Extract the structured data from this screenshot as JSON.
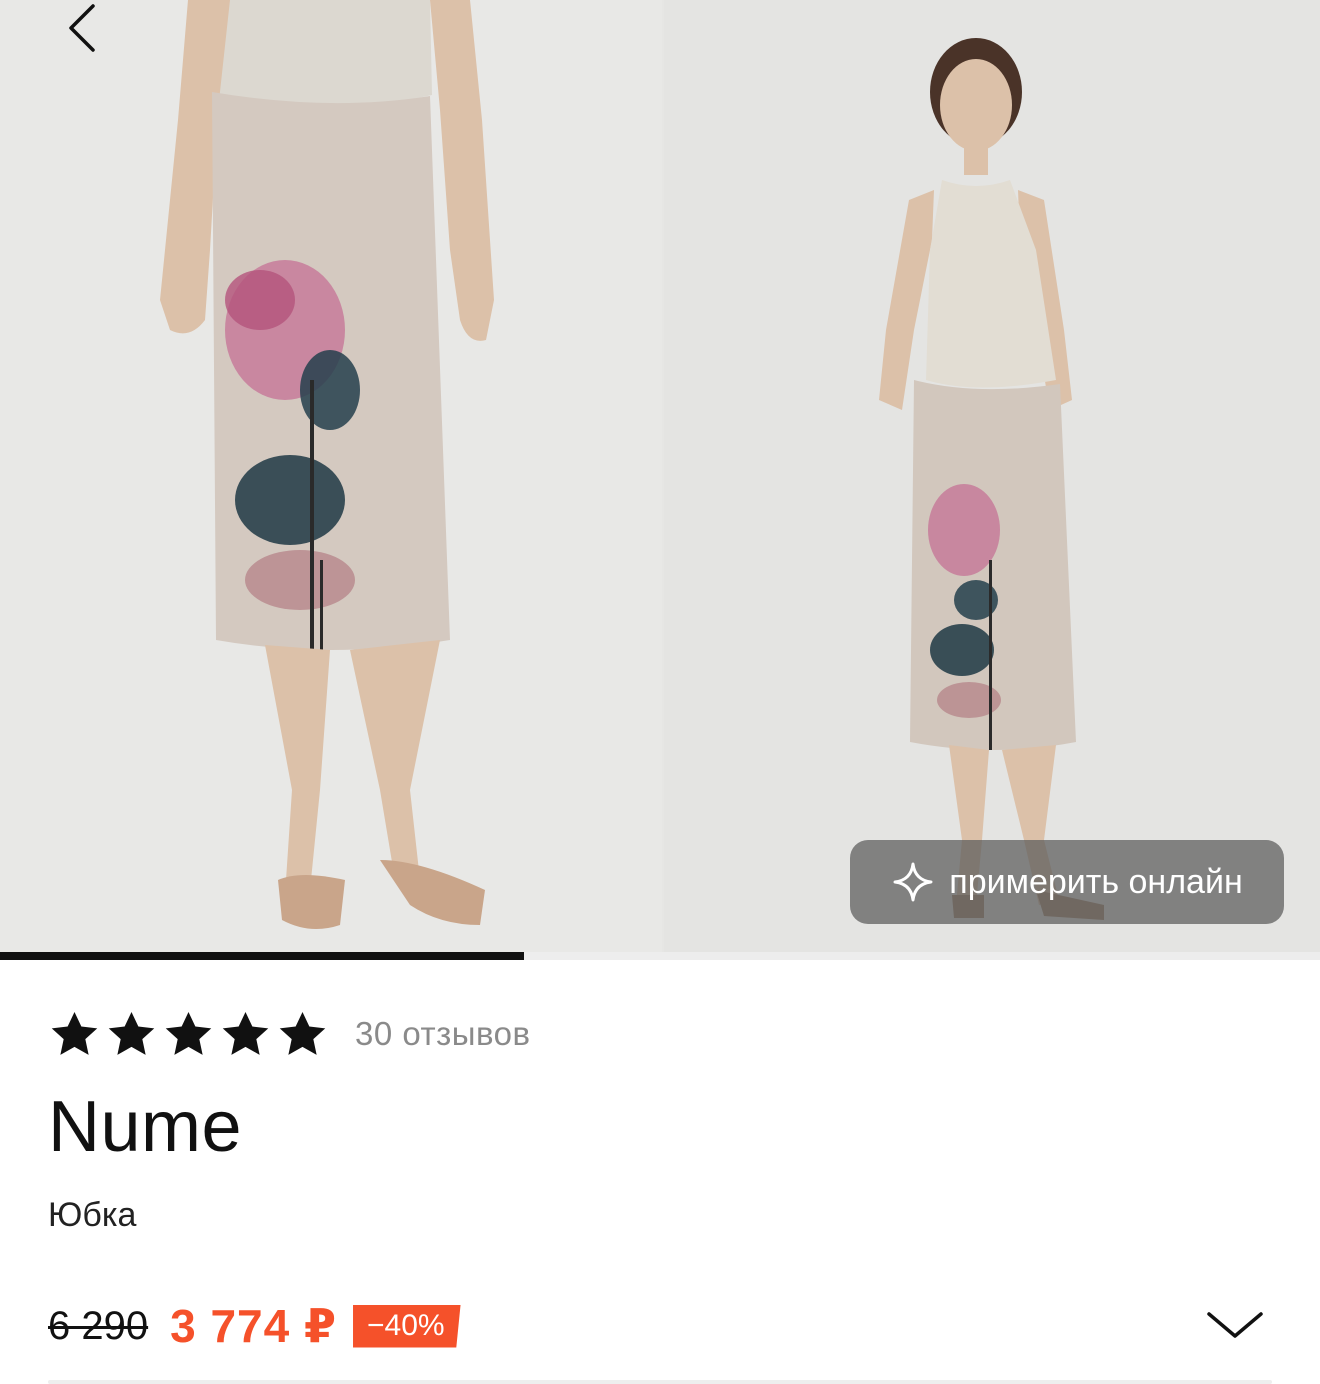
{
  "gallery": {
    "photos": [
      {
        "icon": "product-photo-closeup"
      },
      {
        "icon": "product-photo-full"
      }
    ],
    "active_index": 0,
    "progress_fraction": 0.397,
    "try_on_label": "примерить онлайн"
  },
  "product": {
    "rating_stars": 5,
    "reviews_label": "30 отзывов",
    "brand": "Nume",
    "category": "Юбка",
    "old_price": "6 290",
    "new_price": "3 774 ₽",
    "discount": "−40%"
  },
  "colors": {
    "accent": "#f5512a",
    "text": "#111111",
    "muted": "#8a8a8a"
  }
}
